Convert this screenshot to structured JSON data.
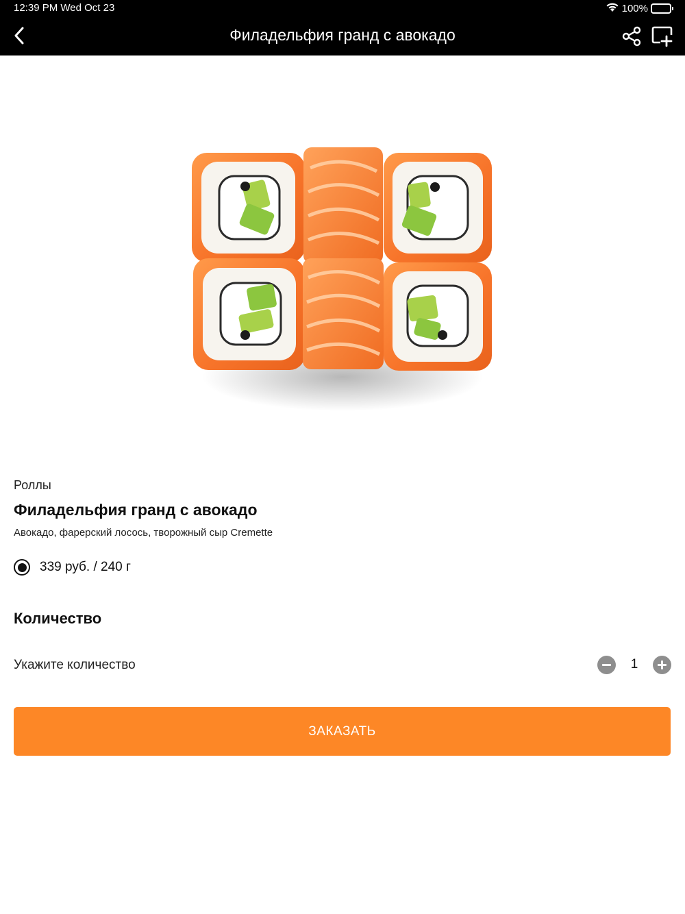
{
  "status_bar": {
    "time": "12:39 PM  Wed Oct 23",
    "battery": "100%",
    "icons": [
      "wifi-icon",
      "battery-icon"
    ]
  },
  "nav": {
    "title": "Филадельфия гранд с авокадо",
    "icons": [
      "chevron-left-icon",
      "share-icon",
      "add-to-cart-icon"
    ]
  },
  "product": {
    "category": "Роллы",
    "title": "Филадельфия гранд с авокадо",
    "description": "Авокадо, фарерский лосось, творожный сыр Cremette",
    "variant": {
      "label": "339 руб. / 240 г",
      "selected": true
    }
  },
  "quantity": {
    "heading": "Количество",
    "label": "Укажите количество",
    "value": "1"
  },
  "order_button": {
    "label": "ЗАКАЗАТЬ"
  },
  "colors": {
    "accent": "#fd8726",
    "nav_background": "#000000",
    "stepper_button": "#8e8e8e"
  }
}
